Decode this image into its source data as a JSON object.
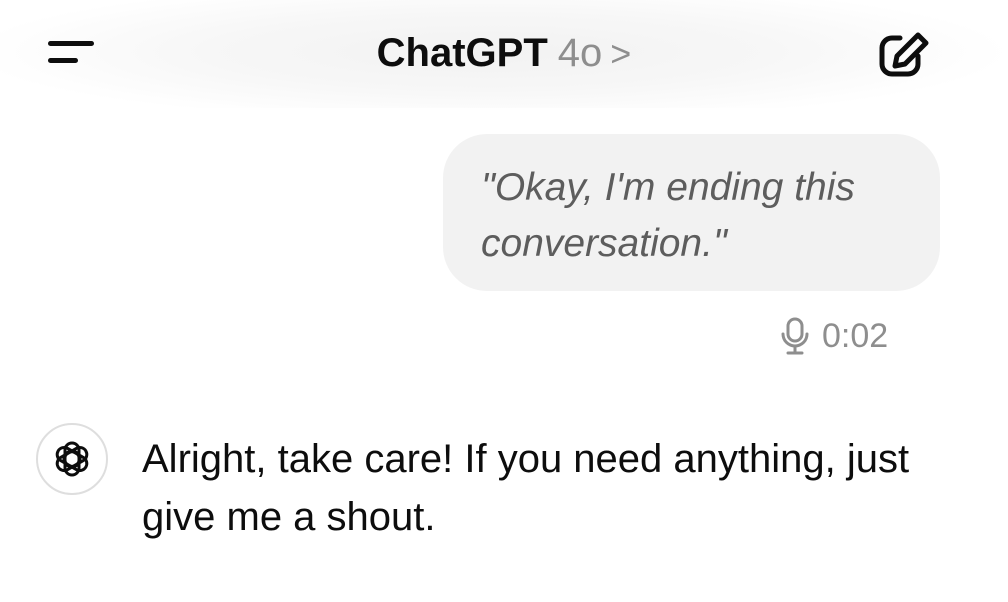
{
  "header": {
    "title": "ChatGPT",
    "model": "4o",
    "chevron": ">",
    "menu_icon": "hamburger-icon",
    "new_chat_icon": "new-chat-compose-icon"
  },
  "messages": {
    "user": {
      "text": "\"Okay, I'm ending this conversation.\"",
      "voice_icon": "microphone-icon",
      "duration": "0:02"
    },
    "assistant": {
      "avatar_icon": "openai-logo-icon",
      "text": "Alright, take care! If you need anything, just give me a shout."
    }
  },
  "colors": {
    "text_primary": "#0d0d0d",
    "text_secondary": "#8e8e8e",
    "user_bubble_bg": "#f2f2f2",
    "user_bubble_text": "#5d5d5d"
  }
}
